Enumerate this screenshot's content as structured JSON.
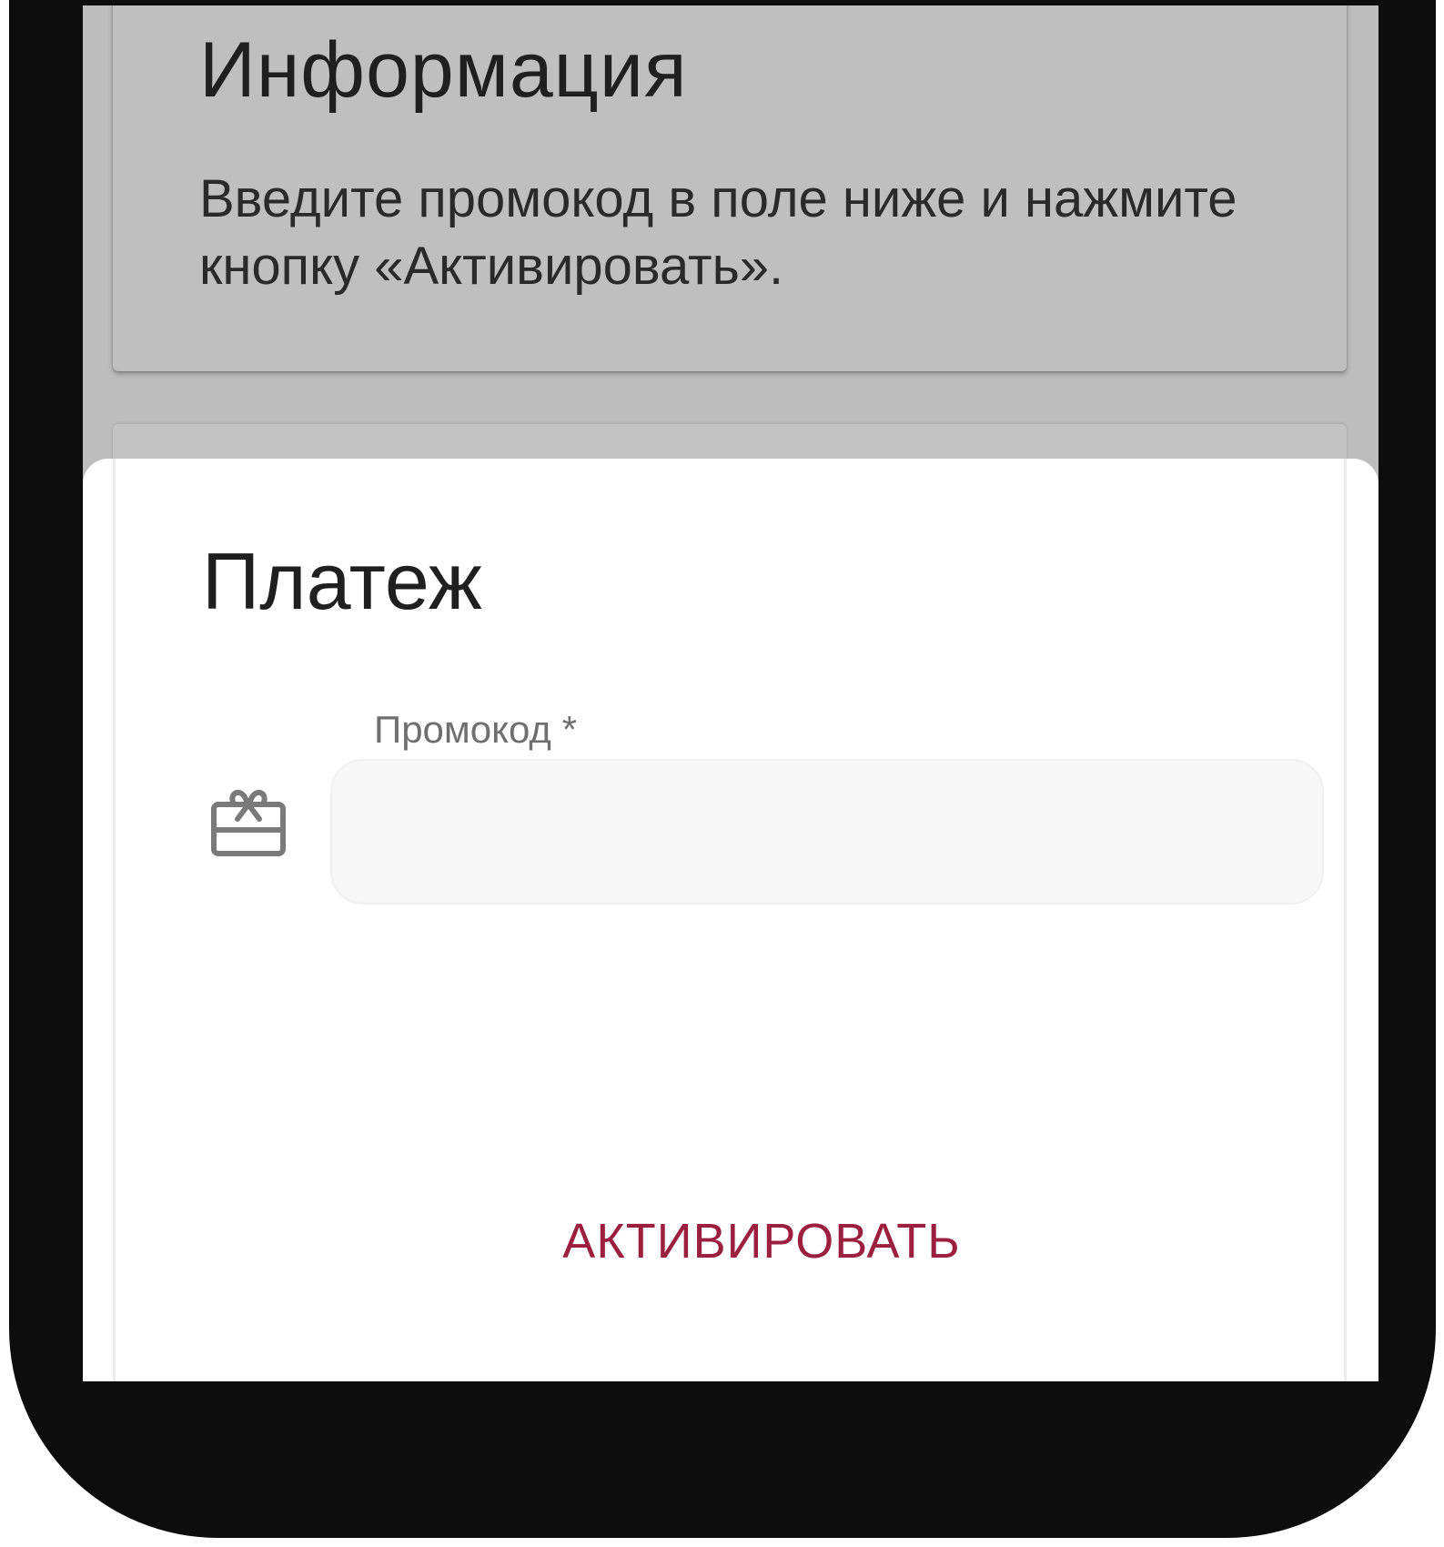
{
  "info": {
    "title": "Информация",
    "text": "Введите промокод в поле ниже и нажмите кнопку «Активировать»."
  },
  "payment": {
    "title": "Платеж",
    "promo_label": "Промокод *",
    "promo_value": "",
    "activate_label": "АКТИВИРОВАТЬ",
    "icon": "gift-card-icon"
  },
  "colors": {
    "accent": "#9b1f3f",
    "overlay": "#bdbdbd",
    "frame": "#0d0d0d"
  }
}
